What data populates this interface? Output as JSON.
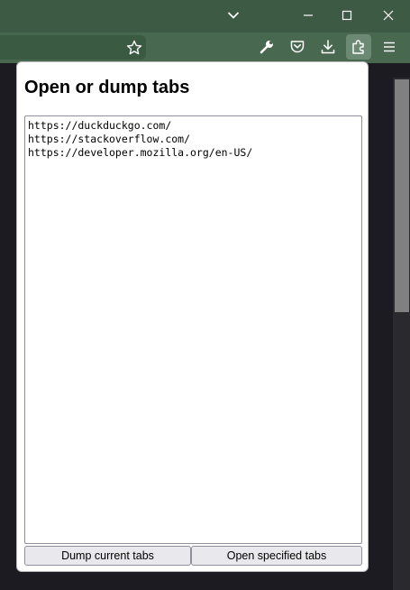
{
  "colors": {
    "titlebar": "#3d5a45",
    "toolbar": "#496850",
    "page_background": "#1c1b22",
    "active_icon_background": "#6c8a73",
    "button_background": "#e9e9ed"
  },
  "titlebar": {
    "controls": [
      "chevron-down-icon",
      "minimize-icon",
      "maximize-icon",
      "close-icon"
    ]
  },
  "toolbar": {
    "icons": [
      "bookmark-star-icon",
      "wrench-icon",
      "pocket-icon",
      "download-icon",
      "extensions-puzzle-icon",
      "menu-hamburger-icon"
    ],
    "active_icon": "extensions-puzzle-icon"
  },
  "popup": {
    "title": "Open or dump tabs",
    "urls_text": "https://duckduckgo.com/\nhttps://stackoverflow.com/\nhttps://developer.mozilla.org/en-US/",
    "dump_button": "Dump current tabs",
    "open_button": "Open specified tabs"
  }
}
